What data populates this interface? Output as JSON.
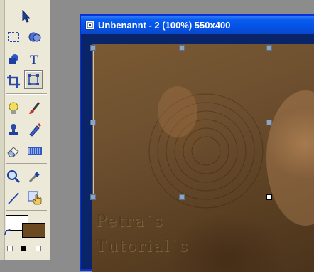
{
  "document_window": {
    "title": "Unbenannt - 2 (100%) 550x400"
  },
  "canvas": {
    "watermark_line1": "Petra`s",
    "watermark_line2": "Tutorial`s"
  },
  "toolbox": {
    "foreground_color": "#ffffff",
    "background_color": "#6b4a21",
    "active_tool": "transform-tool",
    "tools": [
      "arrow-icon",
      "marquee-icon",
      "lasso-icon",
      "shape-icon",
      "text-icon",
      "crop-icon",
      "transform-icon",
      "bulb-icon",
      "brush-icon",
      "stamp-icon",
      "pencil-icon",
      "eraser-icon",
      "pattern-icon",
      "zoom-icon",
      "eyedropper-icon",
      "line-icon",
      "hand-icon"
    ]
  },
  "colors": {
    "titlebar": "#0a5ef0",
    "selection": "#b9c5d6"
  }
}
